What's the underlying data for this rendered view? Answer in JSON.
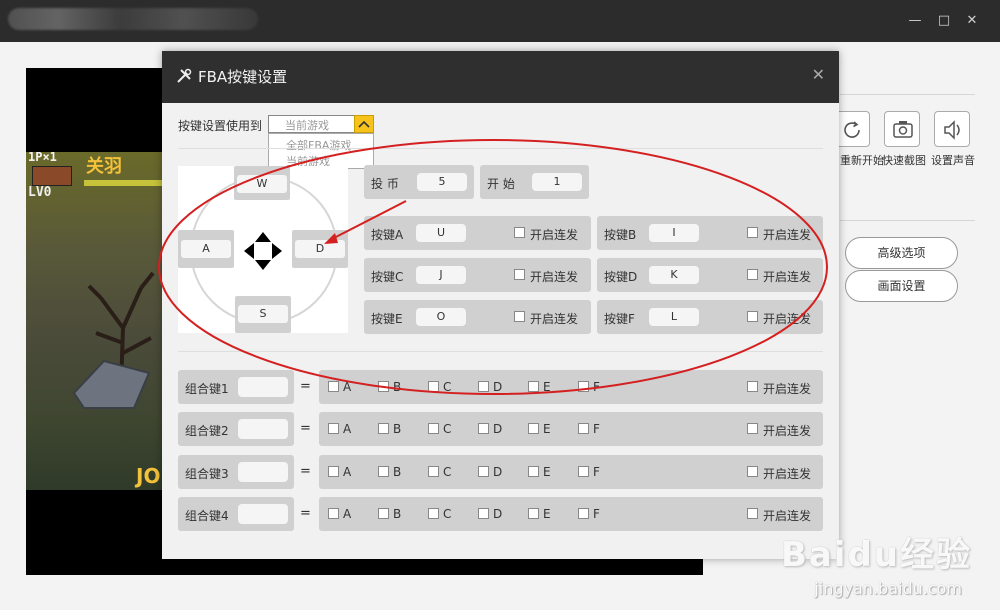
{
  "window": {
    "minimize_icon": "minimize-icon",
    "maximize_icon": "maximize-icon",
    "close_icon": "close-icon"
  },
  "game": {
    "hud_player": "1P×1",
    "hud_name": "关羽",
    "hud_level": "LV0",
    "hud_bottom": "JO"
  },
  "toolbar": {
    "restart_label": "重新开始",
    "screenshot_label": "快速截图",
    "sound_label": "设置声音",
    "advanced_label": "高级选项",
    "display_label": "画面设置"
  },
  "dialog": {
    "title": "FBA按键设置",
    "apply_label": "按键设置使用到",
    "apply_value": "当前游戏",
    "apply_options": [
      "全部FBA游戏",
      "当前游戏"
    ],
    "dpad": {
      "up": "W",
      "left": "A",
      "right": "D",
      "down": "S"
    },
    "coin_label": "投 币",
    "coin_value": "5",
    "start_label": "开 始",
    "start_value": "1",
    "autofire_label": "开启连发",
    "buttons": [
      {
        "label": "按键A",
        "value": "U"
      },
      {
        "label": "按键B",
        "value": "I"
      },
      {
        "label": "按键C",
        "value": "J"
      },
      {
        "label": "按键D",
        "value": "K"
      },
      {
        "label": "按键E",
        "value": "O"
      },
      {
        "label": "按键F",
        "value": "L"
      }
    ],
    "combo_equals": "=",
    "combo_options": [
      "A",
      "B",
      "C",
      "D",
      "E",
      "F"
    ],
    "combos": [
      {
        "label": "组合键1",
        "value": ""
      },
      {
        "label": "组合键2",
        "value": ""
      },
      {
        "label": "组合键3",
        "value": ""
      },
      {
        "label": "组合键4",
        "value": ""
      }
    ]
  },
  "watermark": {
    "main": "Baidu经验",
    "sub": "jingyan.baidu.com"
  },
  "colors": {
    "accent_dropdown": "#f6c21b",
    "annotation": "#d42020",
    "titlebar": "#2c2c2c"
  }
}
